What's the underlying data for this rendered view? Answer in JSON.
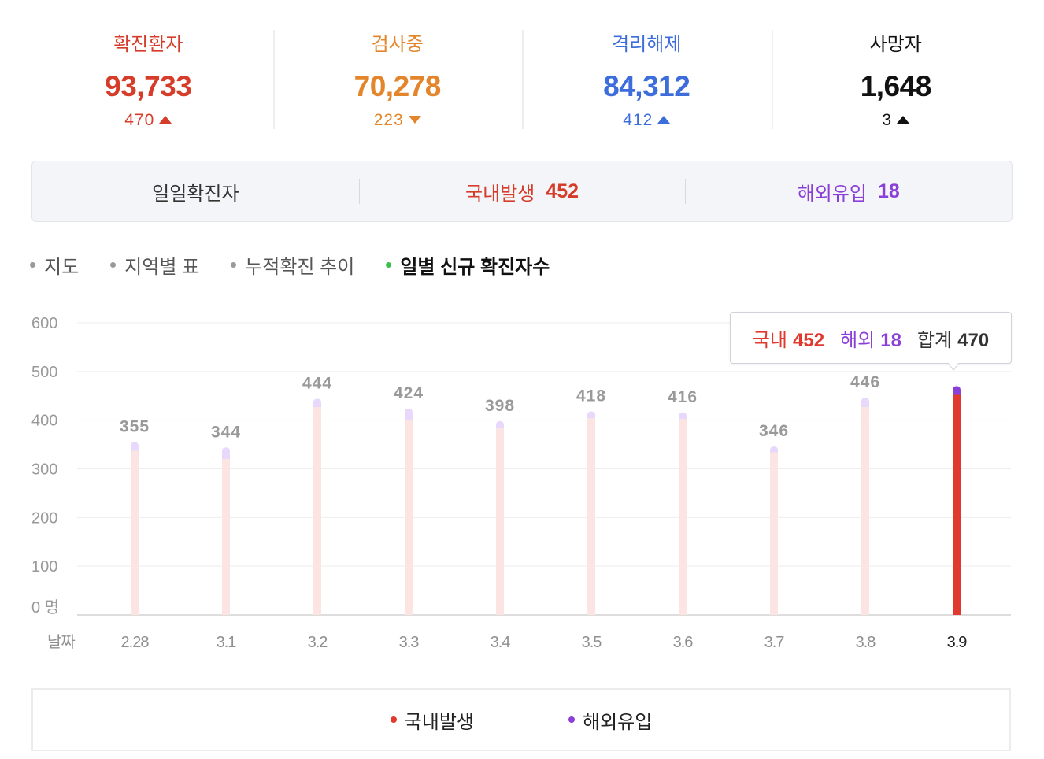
{
  "stats": [
    {
      "label": "확진환자",
      "value": "93,733",
      "delta": "470",
      "direction": "up",
      "color": "#d63c2a"
    },
    {
      "label": "검사중",
      "value": "70,278",
      "delta": "223",
      "direction": "down",
      "color": "#e3862b"
    },
    {
      "label": "격리해제",
      "value": "84,312",
      "delta": "412",
      "direction": "up",
      "color": "#3c6ddb"
    },
    {
      "label": "사망자",
      "value": "1,648",
      "delta": "3",
      "direction": "up",
      "color": "#111111"
    }
  ],
  "daily": {
    "label": "일일확진자",
    "domestic_label": "국내발생",
    "domestic_value": "452",
    "overseas_label": "해외유입",
    "overseas_value": "18"
  },
  "tabs": [
    {
      "label": "지도",
      "active": false
    },
    {
      "label": "지역별 표",
      "active": false
    },
    {
      "label": "누적확진 추이",
      "active": false
    },
    {
      "label": "일별 신규 확진자수",
      "active": true
    }
  ],
  "tooltip": {
    "domestic_label": "국내",
    "domestic_value": "452",
    "overseas_label": "해외",
    "overseas_value": "18",
    "total_label": "합계",
    "total_value": "470"
  },
  "legend": {
    "domestic": "국내발생",
    "overseas": "해외유입"
  },
  "colors": {
    "domestic": "#e0392d",
    "overseas": "#8a3fd8",
    "domestic_faded": "#fbe4e2",
    "overseas_faded": "#e8d8fb",
    "grid": "#eeeeee"
  },
  "chart_data": {
    "type": "bar",
    "stacked": true,
    "categories": [
      "2.28",
      "3.1",
      "3.2",
      "3.3",
      "3.4",
      "3.5",
      "3.6",
      "3.7",
      "3.8",
      "3.9"
    ],
    "series": [
      {
        "name": "국내발생",
        "values": [
          337,
          320,
          427,
          401,
          383,
          404,
          402,
          334,
          427,
          452
        ]
      },
      {
        "name": "해외유입",
        "values": [
          18,
          24,
          17,
          23,
          15,
          14,
          14,
          12,
          19,
          18
        ]
      }
    ],
    "totals": [
      355,
      344,
      444,
      424,
      398,
      418,
      416,
      346,
      446,
      470
    ],
    "highlight_index": 9,
    "xlabel": "날짜",
    "ylabel": "",
    "y_unit": "명",
    "yticks": [
      0,
      100,
      200,
      300,
      400,
      500,
      600
    ],
    "ylim": [
      0,
      600
    ],
    "grid": true
  }
}
